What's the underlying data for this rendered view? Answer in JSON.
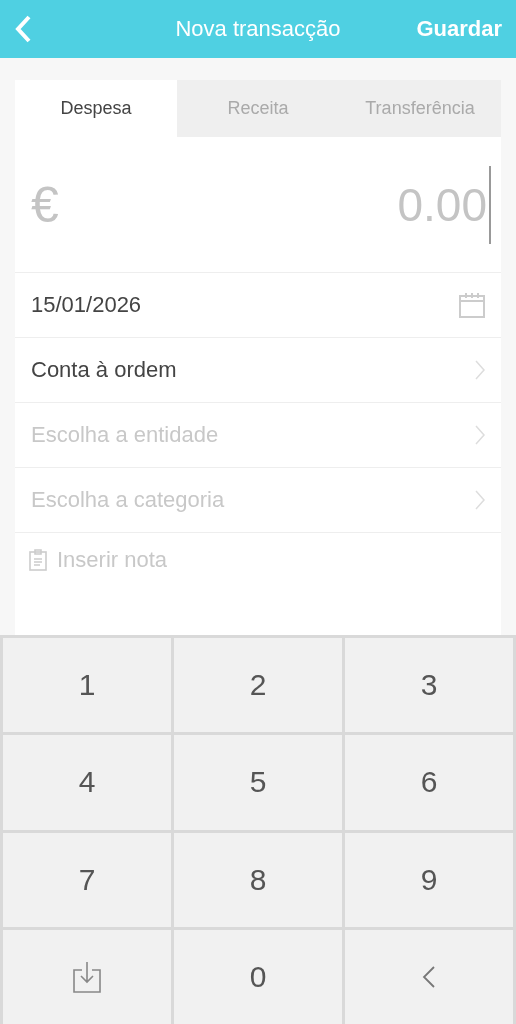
{
  "header": {
    "title": "Nova transacção",
    "action": "Guardar"
  },
  "tabs": [
    {
      "label": "Despesa",
      "selected": true
    },
    {
      "label": "Receita",
      "selected": false
    },
    {
      "label": "Transferência",
      "selected": false
    }
  ],
  "amount": {
    "currency": "€",
    "placeholder": "0.00"
  },
  "rows": [
    {
      "kind": "date",
      "value": "15/01/2026"
    },
    {
      "kind": "select",
      "value": "Conta à ordem"
    },
    {
      "kind": "select",
      "placeholder": "Escolha a entidade"
    },
    {
      "kind": "select",
      "placeholder": "Escolha a categoria"
    }
  ],
  "note": {
    "placeholder": "Inserir nota"
  },
  "keypad": [
    {
      "kind": "digit",
      "label": "1"
    },
    {
      "kind": "digit",
      "label": "2"
    },
    {
      "kind": "digit",
      "label": "3"
    },
    {
      "kind": "digit",
      "label": "4"
    },
    {
      "kind": "digit",
      "label": "5"
    },
    {
      "kind": "digit",
      "label": "6"
    },
    {
      "kind": "digit",
      "label": "7"
    },
    {
      "kind": "digit",
      "label": "8"
    },
    {
      "kind": "digit",
      "label": "9"
    },
    {
      "kind": "import"
    },
    {
      "kind": "digit",
      "label": "0"
    },
    {
      "kind": "backspace"
    }
  ]
}
